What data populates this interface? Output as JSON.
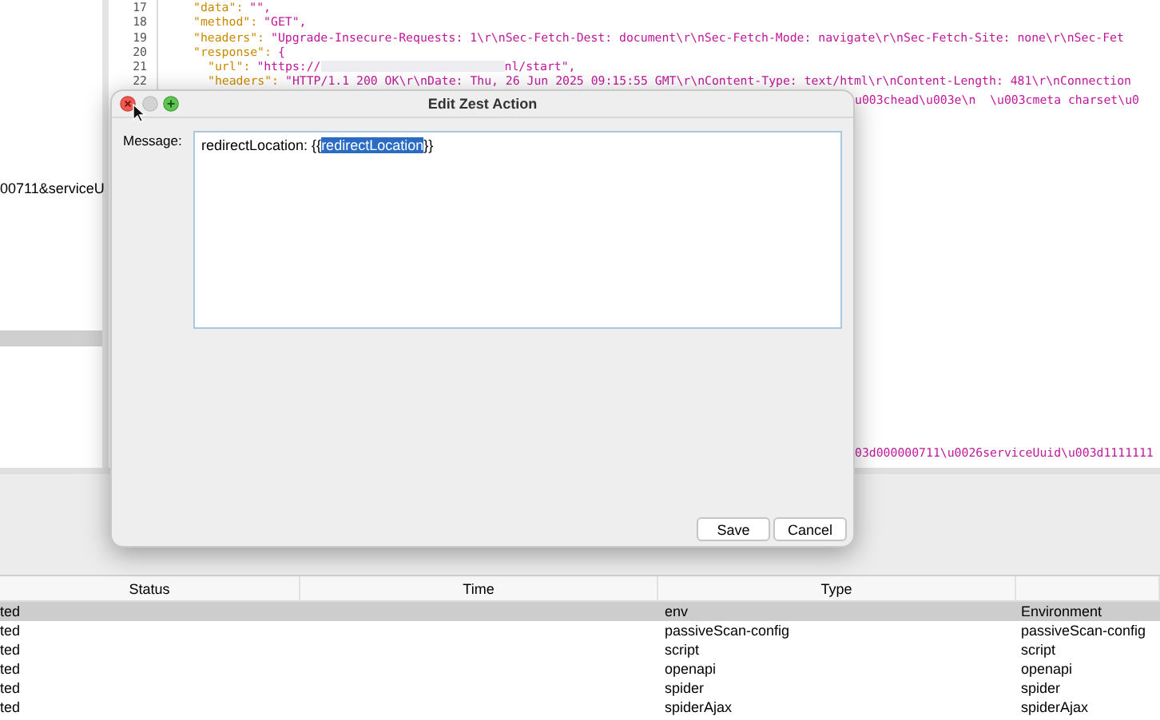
{
  "editor": {
    "lines": [
      {
        "number": "17",
        "key": "\"data\":",
        "value": "\"\","
      },
      {
        "number": "18",
        "key": "\"method\":",
        "value": "\"GET\","
      },
      {
        "number": "19",
        "key": "\"headers\":",
        "value": "\"Upgrade-Insecure-Requests: 1\\r\\nSec-Fetch-Dest: document\\r\\nSec-Fetch-Mode: navigate\\r\\nSec-Fetch-Site: none\\r\\nSec-Fet"
      },
      {
        "number": "20",
        "key": "\"response\":",
        "value": "{",
        "children": [
          {
            "number": "21",
            "key": "\"url\":",
            "value": "\"https://",
            "redacted": true,
            "value_end": "nl/start\","
          },
          {
            "number": "22",
            "key": "\"headers\":",
            "value": "\"HTTP/1.1 200 OK\\r\\nDate: Thu, 26 Jun 2025 09:15:55 GMT\\r\\nContent-Type: text/html\\r\\nContent-Length: 481\\r\\nConnection"
          }
        ]
      }
    ],
    "fragments": [
      "u003chead\\u003e\\n  \\u003cmeta charset\\u0",
      "03d000000711\\u0026serviceUuid\\u003d1111111"
    ]
  },
  "left_panel": {
    "text": "00711&serviceU"
  },
  "dialog": {
    "title": "Edit Zest Action",
    "label": "Message:",
    "segments": [
      {
        "text": "redirectLocation: {{",
        "selected": false
      },
      {
        "text": "redirectLocation",
        "selected": true
      },
      {
        "text": "}}",
        "selected": false
      }
    ],
    "buttons": [
      "Save",
      "Cancel"
    ]
  },
  "table": {
    "columns": [
      "Status",
      "Time",
      "Type",
      ""
    ],
    "rows": [
      {
        "status": "ted",
        "type": "env",
        "name": "Environment",
        "selected": true
      },
      {
        "status": "ted",
        "type": "passiveScan-config",
        "name": "passiveScan-config",
        "selected": false
      },
      {
        "status": "ted",
        "type": "script",
        "name": "script",
        "selected": false
      },
      {
        "status": "ted",
        "type": "openapi",
        "name": "openapi",
        "selected": false
      },
      {
        "status": "ted",
        "type": "spider",
        "name": "spider",
        "selected": false
      },
      {
        "status": "ted",
        "type": "spiderAjax",
        "name": "spiderAjax",
        "selected": false
      }
    ]
  }
}
